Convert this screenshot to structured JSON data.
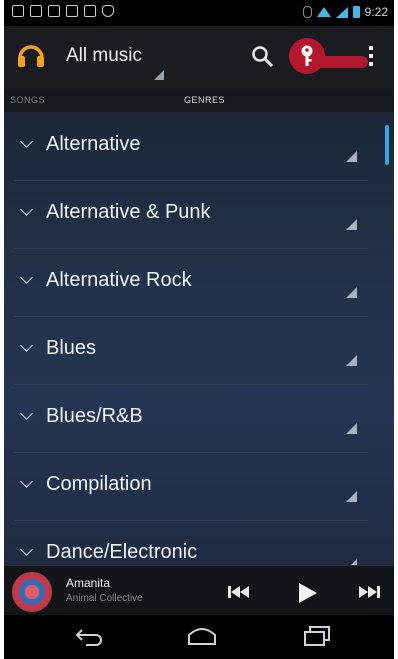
{
  "status_bar": {
    "time": "9:22"
  },
  "action_bar": {
    "title": "All music",
    "icons": [
      "headphones-icon",
      "search-icon",
      "hint-pin-icon",
      "overflow-menu-icon"
    ]
  },
  "tabs": {
    "songs": "SONGS",
    "genres": "GENRES"
  },
  "genres": [
    "Alternative",
    "Alternative & Punk",
    "Alternative Rock",
    "Blues",
    "Blues/R&B",
    "Compilation",
    "Dance/Electronic"
  ],
  "now_playing": {
    "title": "Amanita",
    "artist": "Animal Collective",
    "controls": [
      "previous-icon",
      "play-icon",
      "next-icon"
    ]
  },
  "nav": [
    "back-icon",
    "home-icon",
    "recent-apps-icon"
  ],
  "colors": {
    "accent": "#35a5de",
    "hint": "#b4182f",
    "headphones": "#f5a21a"
  }
}
